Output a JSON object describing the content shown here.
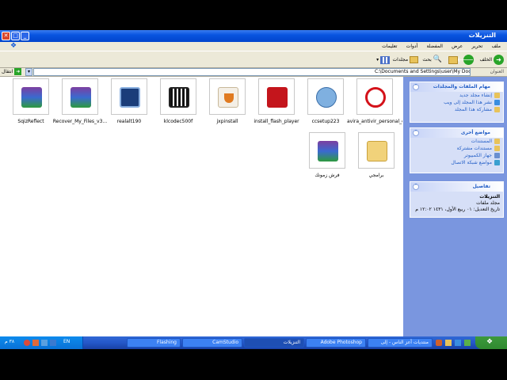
{
  "window": {
    "title": "التنزيلات"
  },
  "menu": [
    "ملف",
    "تحرير",
    "عرض",
    "المفضلة",
    "أدوات",
    "تعليمات"
  ],
  "toolbar": {
    "back": "الخلف",
    "search": "بحث",
    "folders": "مجلدات"
  },
  "address": {
    "label": "العنوان",
    "path": "C:\\Documents and Settings\\user\\My Documents\\التنزيلات",
    "go": "انتقال"
  },
  "files": [
    {
      "name": "SqizReflect",
      "kind": "winrar"
    },
    {
      "name": "Recover_My_Files_v3...",
      "kind": "winrar"
    },
    {
      "name": "realalt190",
      "kind": "real"
    },
    {
      "name": "klcodec500f",
      "kind": "klite"
    },
    {
      "name": "jxpinstall",
      "kind": "java"
    },
    {
      "name": "install_flash_player",
      "kind": "flash"
    },
    {
      "name": "ccsetup223",
      "kind": "setup"
    },
    {
      "name": "avira_antivir_personal_en",
      "kind": "avira"
    },
    {
      "name": "فرش زمونك",
      "kind": "winrar"
    },
    {
      "name": "برامجي",
      "kind": "folder"
    }
  ],
  "sidebar": {
    "tasks": {
      "title": "مهام الملفات والمجلدات",
      "items": [
        "إنشاء مجلد جديد",
        "نشر هذا المجلد إلى ويب",
        "مشاركة هذا المجلد"
      ]
    },
    "places": {
      "title": "مواضع أخرى",
      "items": [
        "المستندات",
        "مستندات مشتركة",
        "جهاز الكمبيوتر",
        "مواضع شبكة الاتصال"
      ]
    },
    "details": {
      "title": "تفاصيل",
      "name": "التنزيلات",
      "type": "مجلد ملفات",
      "modified": "تاريخ التعديل: ٠١ ربيع الأول، ١٤٣١ ١٢:٠٢ م"
    }
  },
  "taskbar": {
    "clock": "٣٨ م",
    "lang": "EN",
    "buttons": [
      "Flashing",
      "CamStudio",
      "التنزيلات",
      "Adobe Photoshop",
      "منتديات أعز الناس - إلى"
    ]
  },
  "colors": {
    "titlebar": "#0a55e0",
    "taskbar": "#2457c9",
    "sidepanel": "#7a96df",
    "link": "#215dc6"
  }
}
